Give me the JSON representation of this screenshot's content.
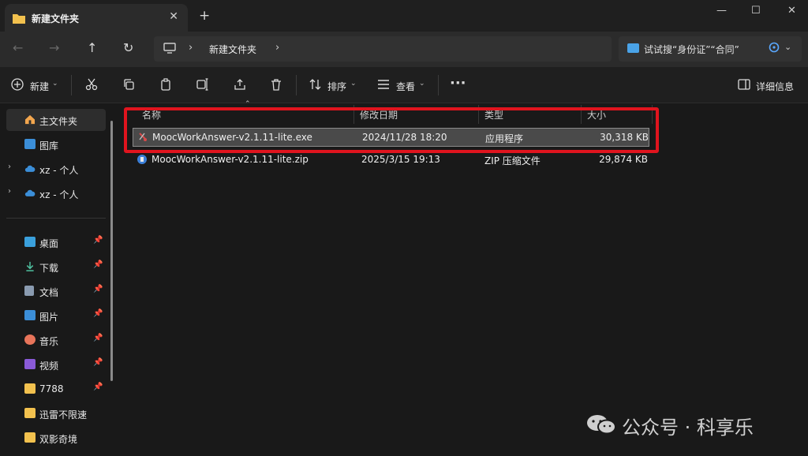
{
  "tab": {
    "title": "新建文件夹",
    "close": "✕",
    "new_tab": "+"
  },
  "window": {
    "minimize": "—",
    "maximize": "☐",
    "close": "✕"
  },
  "nav": {
    "back": "←",
    "forward": "→",
    "up": "↑",
    "refresh": "↻"
  },
  "address": {
    "crumb": "新建文件夹",
    "chevron": "›"
  },
  "search": {
    "text": "试试搜“身份证”“合同”",
    "chevron": "⌄"
  },
  "toolbar": {
    "new_label": "新建",
    "sort_label": "排序",
    "view_label": "查看",
    "more": "···",
    "details_label": "详细信息",
    "caret": "⌄"
  },
  "sidebar": {
    "items": [
      {
        "label": "主文件夹"
      },
      {
        "label": "图库"
      },
      {
        "label": "xz - 个人"
      },
      {
        "label": "xz - 个人"
      },
      {
        "label": "桌面"
      },
      {
        "label": "下载"
      },
      {
        "label": "文档"
      },
      {
        "label": "图片"
      },
      {
        "label": "音乐"
      },
      {
        "label": "视频"
      },
      {
        "label": "7788"
      },
      {
        "label": "迅雷不限速"
      },
      {
        "label": "双影奇境"
      }
    ]
  },
  "columns": {
    "name": "名称",
    "modified": "修改日期",
    "type": "类型",
    "size": "大小"
  },
  "files": [
    {
      "name": "MoocWorkAnswer-v2.1.11-lite.exe",
      "modified": "2024/11/28 18:20",
      "type": "应用程序",
      "size": "30,318 KB"
    },
    {
      "name": "MoocWorkAnswer-v2.1.11-lite.zip",
      "modified": "2025/3/15 19:13",
      "type": "ZIP 压缩文件",
      "size": "29,874 KB"
    }
  ],
  "watermark": {
    "text": "公众号 · 科享乐"
  },
  "colors": {
    "highlight": "#e0141e",
    "folder": "#f2c14e",
    "accent": "#4aa3e8"
  }
}
